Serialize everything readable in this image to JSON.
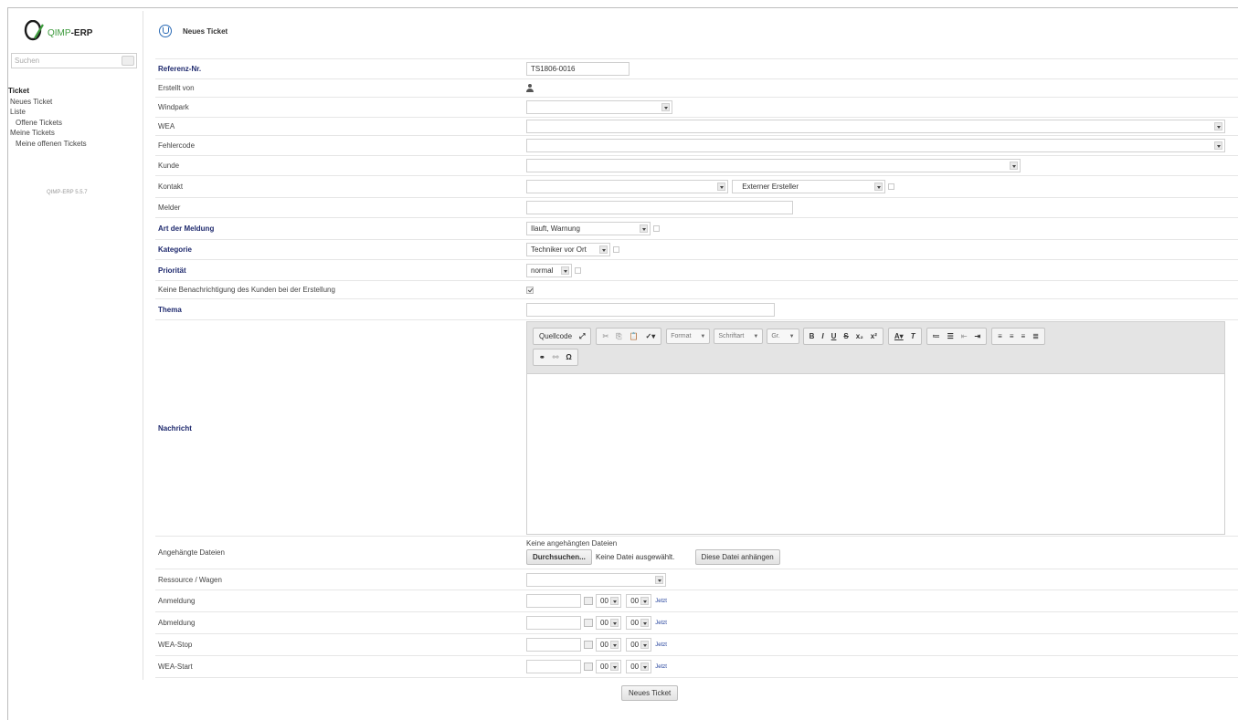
{
  "app": {
    "logo_green": "QIMP",
    "logo_dark": "-ERP",
    "version": "QIMP-ERP 5.5.7"
  },
  "sidebar": {
    "search_placeholder": "Suchen",
    "items": [
      {
        "label": "Ticket"
      },
      {
        "label": "Neues Ticket"
      },
      {
        "label": "Liste"
      },
      {
        "label": "Offene Tickets"
      },
      {
        "label": "Meine Tickets"
      },
      {
        "label": "Meine offenen Tickets"
      }
    ]
  },
  "page": {
    "title": "Neues Ticket"
  },
  "form": {
    "referenz": {
      "label": "Referenz-Nr.",
      "value": "TS1806-0016"
    },
    "erstellt": {
      "label": "Erstellt von"
    },
    "windpark": {
      "label": "Windpark"
    },
    "wea": {
      "label": "WEA"
    },
    "fehlercode": {
      "label": "Fehlercode"
    },
    "kunde": {
      "label": "Kunde"
    },
    "kontakt": {
      "label": "Kontakt",
      "second_value": "Externer Ersteller"
    },
    "melder": {
      "label": "Melder"
    },
    "art": {
      "label": "Art der Meldung",
      "value": "Ilauft, Warnung"
    },
    "kategorie": {
      "label": "Kategorie",
      "value": "Techniker vor Ort"
    },
    "prioritaet": {
      "label": "Priorität",
      "value": "normal"
    },
    "keine_benachrichtigung": {
      "label": "Keine Benachrichtigung des Kunden bei der Erstellung",
      "checked": true
    },
    "thema": {
      "label": "Thema"
    },
    "nachricht": {
      "label": "Nachricht"
    },
    "editor": {
      "source_label": "Quellcode",
      "format_label": "Format",
      "schriftart_label": "Schriftart",
      "groesse_label": "Gr.",
      "bold": "B",
      "italic": "I",
      "underline": "U",
      "strike": "S",
      "sub": "x₂",
      "sup": "x²",
      "omega": "Ω"
    },
    "dateien": {
      "label": "Angehängte Dateien",
      "none_text": "Keine angehängten Dateien",
      "browse_button": "Durchsuchen...",
      "no_file_text": "Keine Datei ausgewählt.",
      "attach_button": "Diese Datei anhängen"
    },
    "ressource": {
      "label": "Ressource / Wagen"
    },
    "time_rows": [
      {
        "label": "Anmeldung",
        "hour": "00",
        "minute": "00",
        "now": "Jetzt"
      },
      {
        "label": "Abmeldung",
        "hour": "00",
        "minute": "00",
        "now": "Jetzt"
      },
      {
        "label": "WEA-Stop",
        "hour": "00",
        "minute": "00",
        "now": "Jetzt"
      },
      {
        "label": "WEA-Start",
        "hour": "00",
        "minute": "00",
        "now": "Jetzt"
      }
    ],
    "submit_button": "Neues Ticket"
  }
}
